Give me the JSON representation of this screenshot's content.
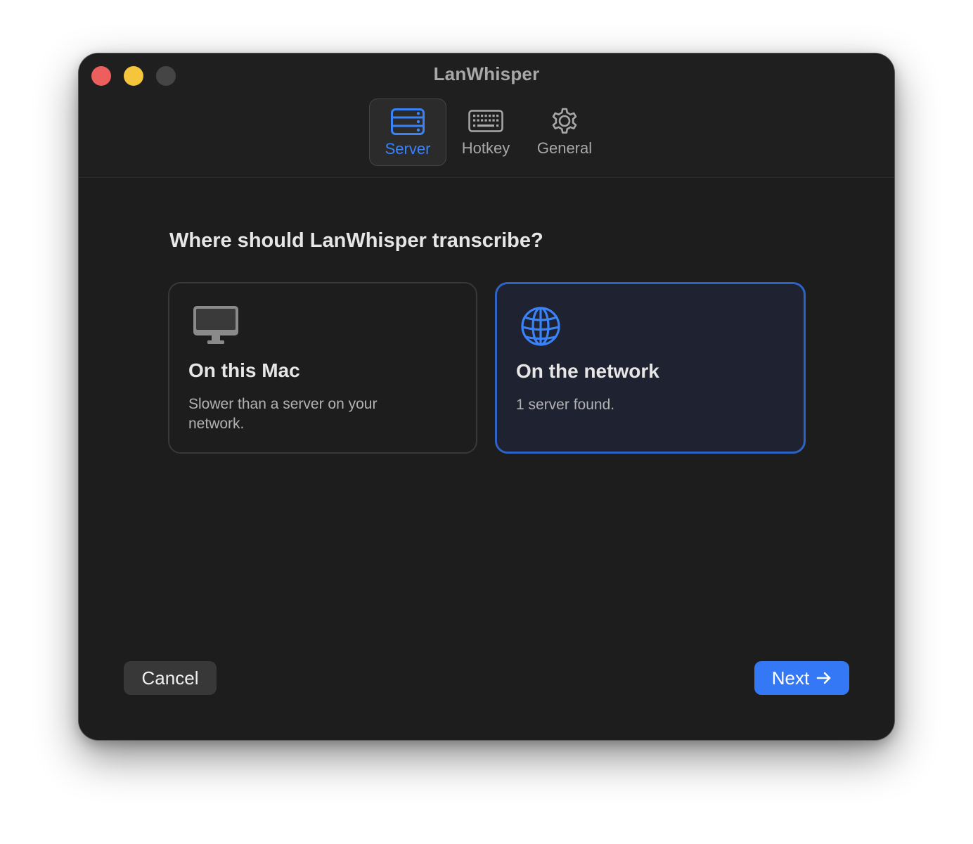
{
  "window": {
    "title": "LanWhisper"
  },
  "tabs": [
    {
      "label": "Server",
      "icon": "server-rack-icon",
      "active": true
    },
    {
      "label": "Hotkey",
      "icon": "keyboard-icon",
      "active": false
    },
    {
      "label": "General",
      "icon": "gear-icon",
      "active": false
    }
  ],
  "main": {
    "question": "Where should LanWhisper transcribe?",
    "options": [
      {
        "title": "On this Mac",
        "description": "Slower than a server on your network.",
        "icon": "desktop-computer-icon",
        "selected": false
      },
      {
        "title": "On the network",
        "description": "1 server found.",
        "icon": "globe-icon",
        "selected": true
      }
    ]
  },
  "footer": {
    "cancel_label": "Cancel",
    "next_label": "Next"
  },
  "colors": {
    "accent": "#3478f6",
    "selected_border": "#2c63c5",
    "window_bg": "#1d1d1d",
    "traffic_close": "#ec5f5c",
    "traffic_minimize": "#f5c63c",
    "traffic_zoom_disabled": "#454545"
  }
}
